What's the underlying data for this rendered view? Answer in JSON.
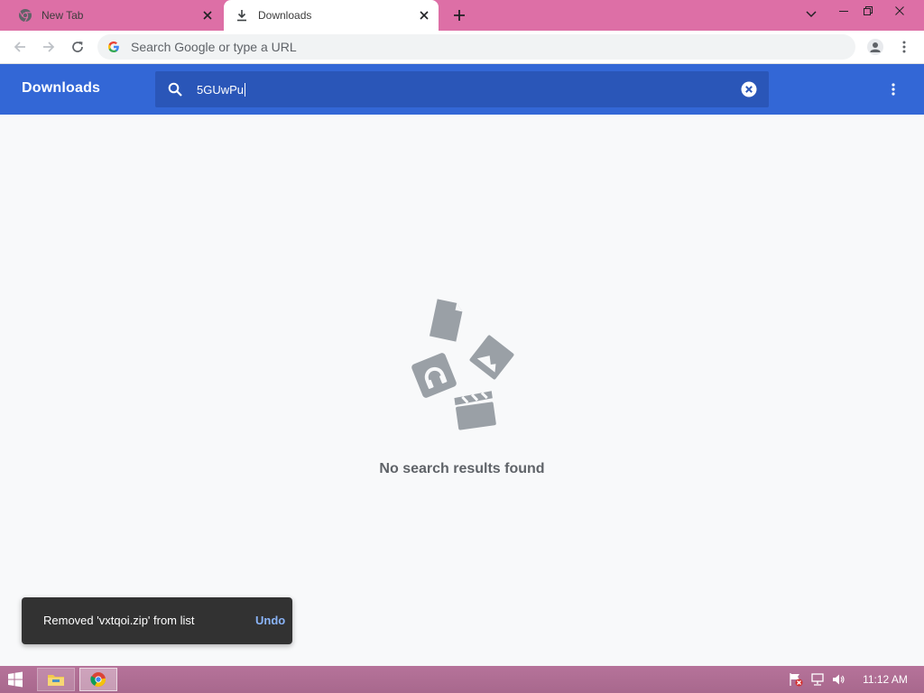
{
  "tabs": [
    {
      "label": "New Tab",
      "icon": "chrome-icon",
      "active": false
    },
    {
      "label": "Downloads",
      "icon": "download-icon",
      "active": true
    }
  ],
  "omnibox": {
    "placeholder": "Search Google or type a URL",
    "value": ""
  },
  "downloads": {
    "title": "Downloads",
    "search_query": "5GUwPu",
    "empty_message": "No search results found"
  },
  "toast": {
    "message": "Removed 'vxtqoi.zip' from list",
    "action": "Undo"
  },
  "taskbar": {
    "clock": "11:12 AM"
  },
  "colors": {
    "tabstrip": "#dd6fa6",
    "header": "#3367d6",
    "search_field": "#2a56b8",
    "page_background": "#f8f9fa",
    "illustration": "#9aa0a6",
    "toast_background": "#323232",
    "toast_action": "#8ab4f8"
  }
}
